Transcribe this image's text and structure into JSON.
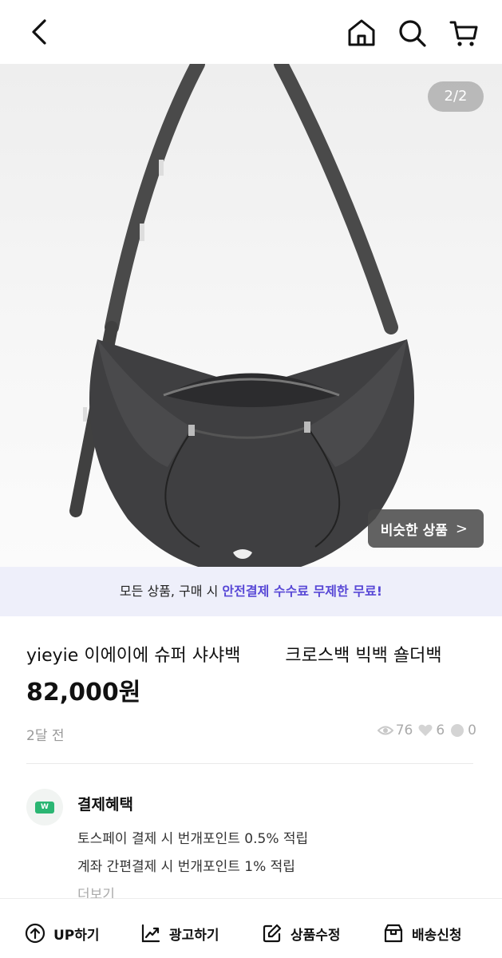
{
  "header": {
    "icons": [
      "back-icon",
      "home-icon",
      "search-icon",
      "cart-icon"
    ]
  },
  "gallery": {
    "page_indicator": "2/2",
    "similar_button": "비슷한 상품",
    "similar_chevron": ">"
  },
  "promo": {
    "prefix": "모든 상품, 구매 시 ",
    "accent": "안전결제 수수료 무제한 무료!"
  },
  "product": {
    "title": "yieyie 이에이에 슈퍼 샤샤백        크로스백 빅백 숄더백",
    "price": "82,000원",
    "time_ago": "2달 전",
    "views": "76",
    "likes": "6",
    "chats": "0"
  },
  "benefit": {
    "badge": "W",
    "title": "결제혜택",
    "line1": "토스페이 결제 시 번개포인트 0.5% 적립",
    "line2": "계좌 간편결제 시 번개포인트 1% 적립",
    "more": "더보기"
  },
  "bottom_bar": {
    "up": "UP하기",
    "ad": "광고하기",
    "edit": "상품수정",
    "ship": "배송신청"
  },
  "colors": {
    "accent": "#5848d6",
    "promo_bg": "#eeeffa",
    "badge_green": "#2bb673"
  }
}
